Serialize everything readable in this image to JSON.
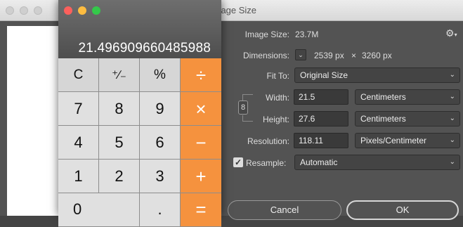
{
  "photoshop": {
    "title": "Image Size",
    "image_size_label": "Image Size:",
    "image_size_value": "23.7M",
    "dimensions_label": "Dimensions:",
    "dimensions_width": "2539 px",
    "dimensions_sep": "×",
    "dimensions_height": "3260 px",
    "fit_to_label": "Fit To:",
    "fit_to_value": "Original Size",
    "width_label": "Width:",
    "width_value": "21.5",
    "width_unit": "Centimeters",
    "height_label": "Height:",
    "height_value": "27.6",
    "height_unit": "Centimeters",
    "resolution_label": "Resolution:",
    "resolution_value": "118.11",
    "resolution_unit": "Pixels/Centimeter",
    "resample_label": "Resample:",
    "resample_checked": true,
    "resample_value": "Automatic",
    "cancel_label": "Cancel",
    "ok_label": "OK"
  },
  "calculator": {
    "display": "21.496909660485988",
    "keys": {
      "clear": "C",
      "sign": "⁺∕₋",
      "percent": "%",
      "divide": "÷",
      "seven": "7",
      "eight": "8",
      "nine": "9",
      "multiply": "×",
      "four": "4",
      "five": "5",
      "six": "6",
      "minus": "−",
      "one": "1",
      "two": "2",
      "three": "3",
      "plus": "+",
      "zero": "0",
      "decimal": ".",
      "equals": "="
    },
    "colors": {
      "operator": "#f5923e",
      "close": "#fc605c",
      "minimize": "#fdbc40",
      "zoom": "#34c84a"
    }
  }
}
